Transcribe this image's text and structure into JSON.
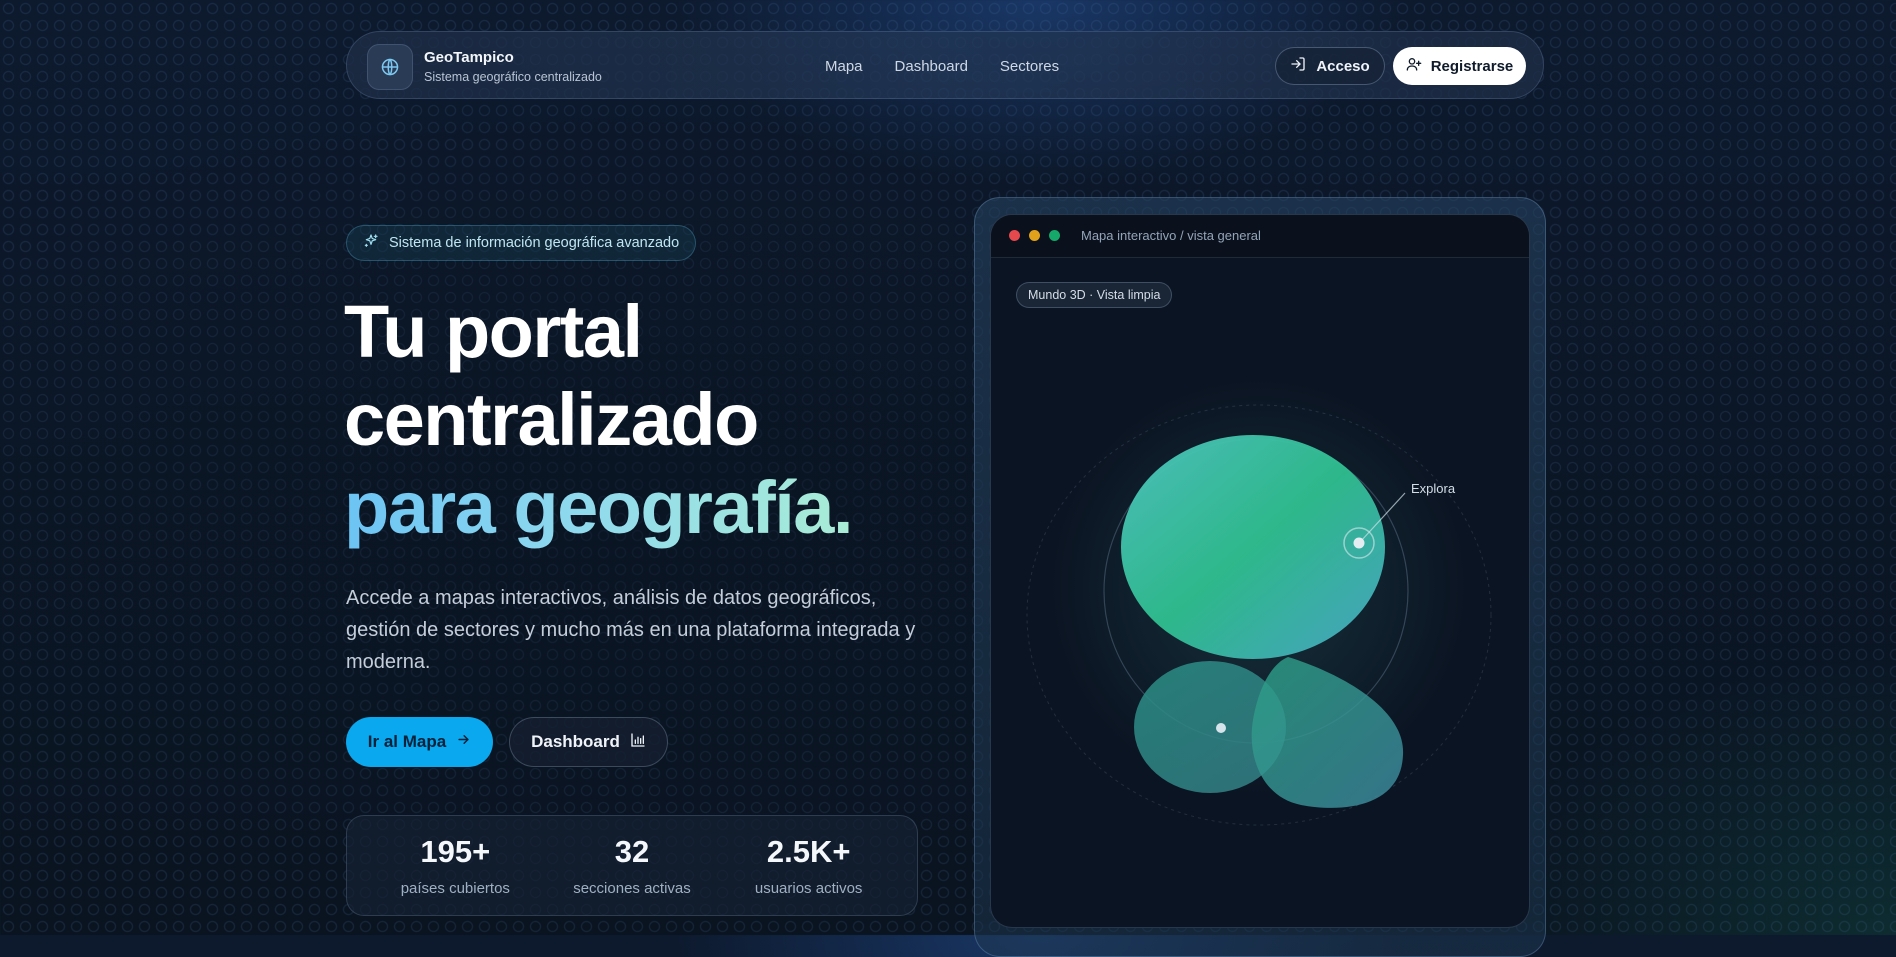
{
  "brand": {
    "title": "GeoTampico",
    "subtitle": "Sistema geográfico centralizado",
    "icon": "globe-icon"
  },
  "nav": {
    "links": [
      "Mapa",
      "Dashboard",
      "Sectores"
    ],
    "login_label": "Acceso",
    "register_label": "Registrarse"
  },
  "hero": {
    "badge": "Sistema de información geográfica avanzado",
    "title_line1": "Tu portal",
    "title_line2": "centralizado",
    "title_line3": "para geografía.",
    "lead": "Accede a mapas interactivos, análisis de datos geográficos, gestión de sectores y mucho más en una plataforma integrada y moderna.",
    "primary_cta": "Ir al Mapa",
    "secondary_cta": "Dashboard"
  },
  "stats": [
    {
      "value": "195+",
      "label": "países cubiertos"
    },
    {
      "value": "32",
      "label": "secciones activas"
    },
    {
      "value": "2.5K+",
      "label": "usuarios activos"
    }
  ],
  "preview": {
    "window_title": "Mapa interactivo / vista general",
    "chip": "Mundo 3D · Vista limpia",
    "marker_label": "Explora"
  },
  "colors": {
    "accent": "#0aa8ee",
    "gradient_start": "#6cc4f4",
    "gradient_end": "#a9ecd6",
    "globe_green": "#2fbf8f",
    "traffic_red": "#e5484d",
    "traffic_yellow": "#e0a21a",
    "traffic_green": "#16a86a"
  }
}
